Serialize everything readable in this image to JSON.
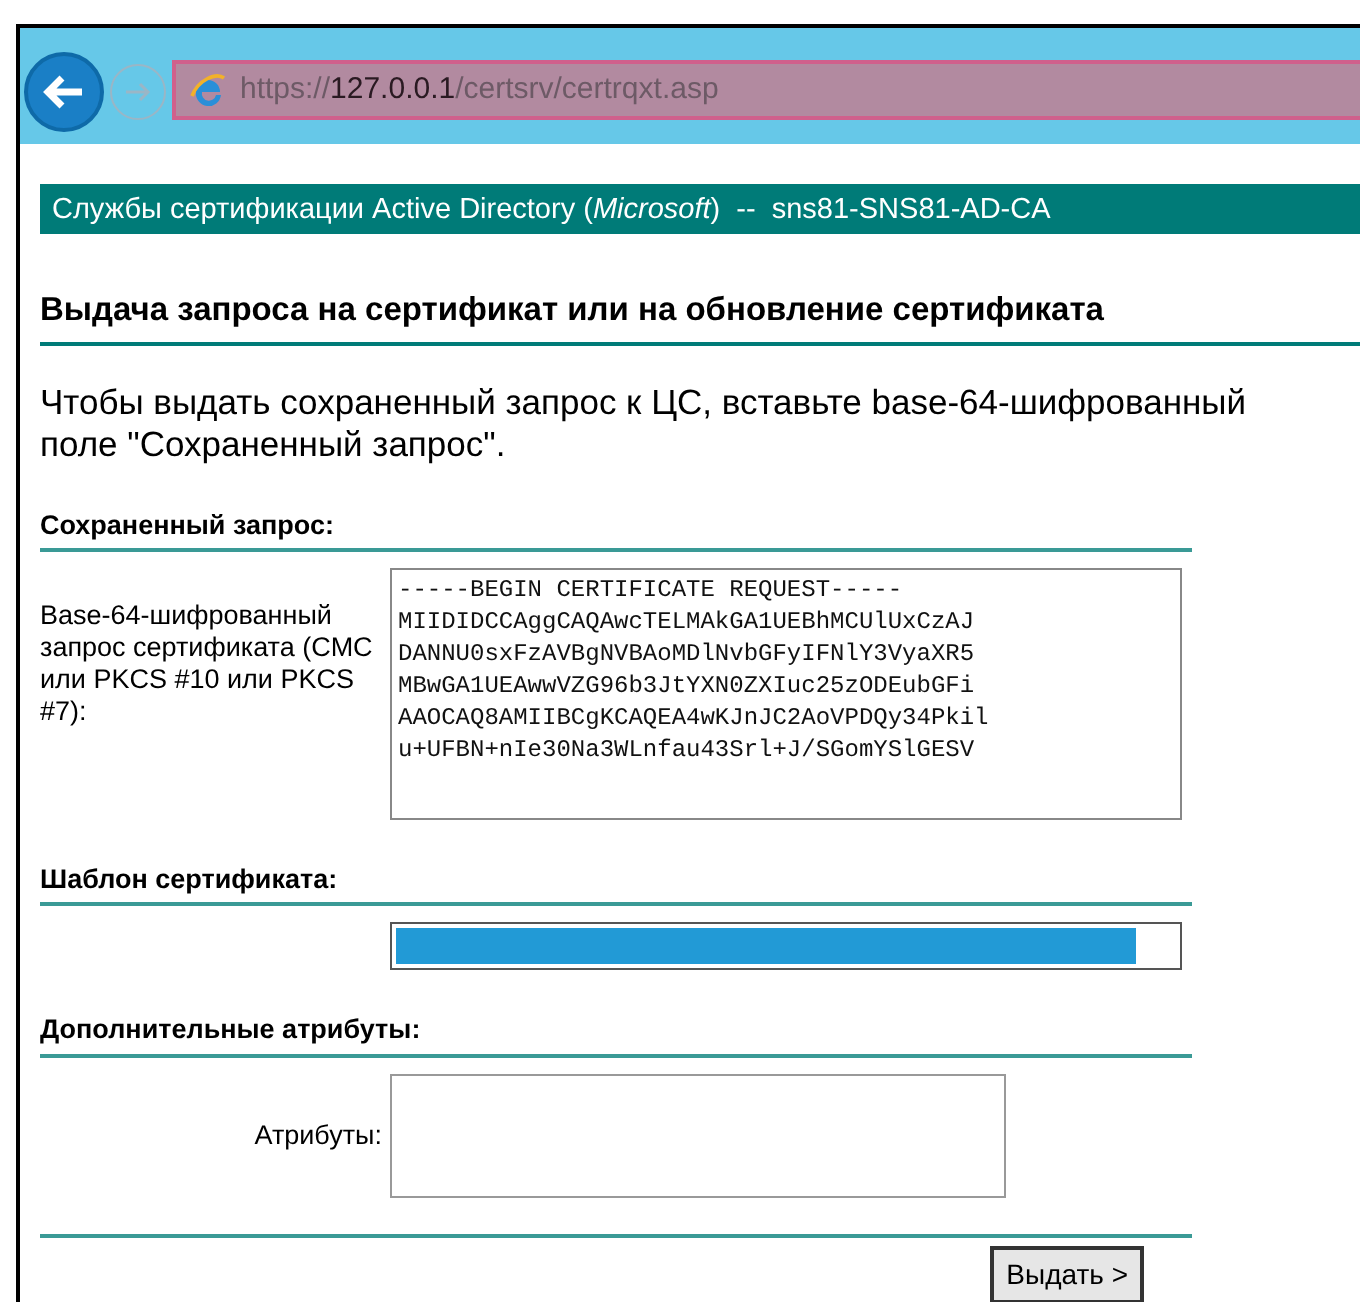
{
  "browser": {
    "url": "https://**127.0.0.1**/certsrv/certrqxt.asp",
    "back_enabled": true,
    "forward_enabled": false
  },
  "banner": {
    "title": "Службы сертификации Active Directory (*Microsoft*)  --  sns81-SNS81-AD-CA"
  },
  "heading": "Выдача запроса на сертификат или на обновление сертификата",
  "intro_lines": [
    "Чтобы выдать сохраненный запрос к ЦС, вставьте base-64-шифрованный",
    "поле \"Сохраненный запрос\"."
  ],
  "sections": [
    {
      "kind": "request",
      "title": "Сохраненный запрос:",
      "label": "Base-64-шифрованный запрос сертификата (CMC или PKCS #10 или PKCS #7):",
      "value_lines": [
        "-----BEGIN CERTIFICATE REQUEST-----",
        "MIIDIDCCAggCAQAwcTELMAkGA1UEBhMCUlUxCzAJ",
        "DANNU0sxFzAVBgNVBAoMDlNvbGFyIFNlY3VyaXR5",
        "MBwGA1UEAwwVZG96b3JtYXN0ZXIuc25zODEubGFi",
        "AAOCAQ8AMIIBCgKCAQEA4wKJnJC2AoVPDQy34Pkil",
        "u+UFBN+nIe30Na3WLnfau43Srl+J/SGomYSlGESV"
      ]
    },
    {
      "kind": "template",
      "title": "Шаблон сертификата:",
      "highlighted": true
    },
    {
      "kind": "attributes",
      "title": "Дополнительные атрибуты:",
      "label": "Атрибуты:"
    }
  ],
  "submit": "Выдать >"
}
